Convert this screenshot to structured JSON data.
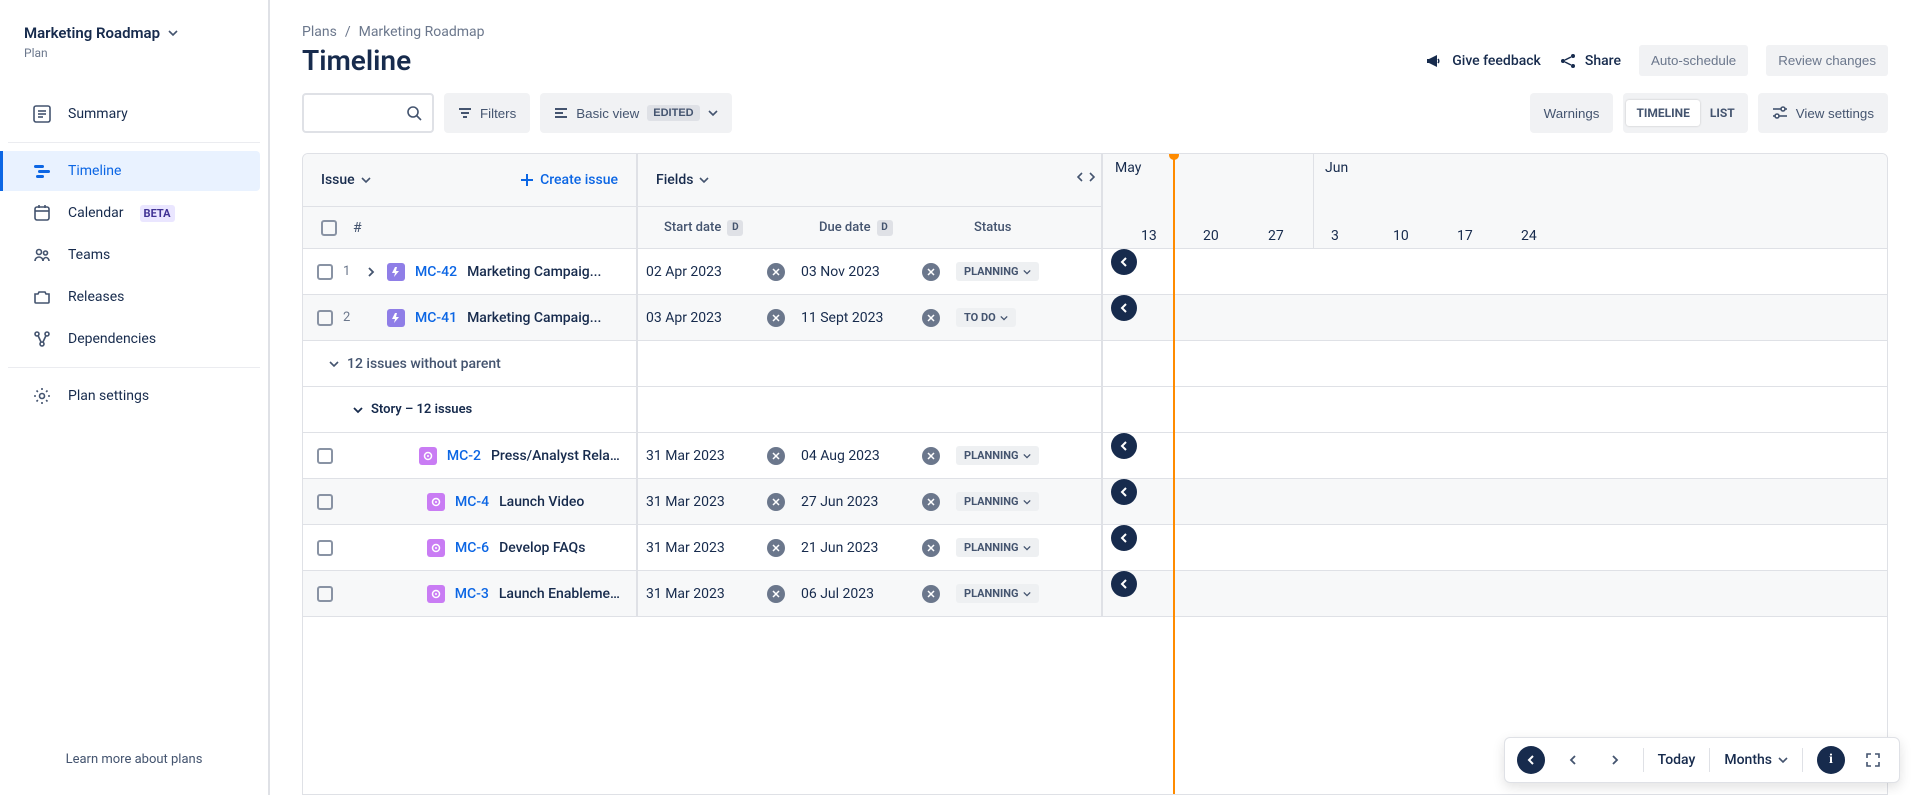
{
  "sidebar": {
    "plan_title": "Marketing Roadmap",
    "plan_sub": "Plan",
    "items": [
      {
        "label": "Summary"
      },
      {
        "label": "Timeline"
      },
      {
        "label": "Calendar"
      },
      {
        "label": "Teams"
      },
      {
        "label": "Releases"
      },
      {
        "label": "Dependencies"
      }
    ],
    "beta_label": "BETA",
    "settings_label": "Plan settings",
    "footer": "Learn more about plans"
  },
  "breadcrumb": {
    "root": "Plans",
    "current": "Marketing Roadmap"
  },
  "page_title": "Timeline",
  "header_actions": {
    "feedback": "Give feedback",
    "share": "Share",
    "autoschedule": "Auto-schedule",
    "review": "Review changes"
  },
  "toolbar": {
    "filters": "Filters",
    "basic_view": "Basic view",
    "edited": "EDITED",
    "warnings": "Warnings",
    "timeline": "TIMELINE",
    "list": "LIST",
    "view_settings": "View settings"
  },
  "table": {
    "issue_col": "Issue",
    "create": "Create issue",
    "fields_col": "Fields",
    "hash": "#",
    "start_date": "Start date",
    "due_date": "Due date",
    "status": "Status",
    "months": [
      "May",
      "Jun"
    ],
    "days": [
      "13",
      "20",
      "27",
      "3",
      "10",
      "17",
      "24"
    ]
  },
  "groups": {
    "no_parent": "12 issues without parent",
    "story": "Story – 12 issues"
  },
  "rows": [
    {
      "num": "1",
      "key": "MC-42",
      "summary": "Marketing Campaig...",
      "start": "02 Apr 2023",
      "due": "03 Nov 2023",
      "status": "PLANNING",
      "type": "epic",
      "expandable": true
    },
    {
      "num": "2",
      "key": "MC-41",
      "summary": "Marketing Campaig...",
      "start": "03 Apr 2023",
      "due": "11 Sept 2023",
      "status": "TO DO",
      "type": "epic",
      "expandable": false
    },
    {
      "num": "",
      "key": "MC-2",
      "summary": "Press/Analyst Relations",
      "start": "31 Mar 2023",
      "due": "04 Aug 2023",
      "status": "PLANNING",
      "type": "story"
    },
    {
      "num": "",
      "key": "MC-4",
      "summary": "Launch Video",
      "start": "31 Mar 2023",
      "due": "27 Jun 2023",
      "status": "PLANNING",
      "type": "story"
    },
    {
      "num": "",
      "key": "MC-6",
      "summary": "Develop FAQs",
      "start": "31 Mar 2023",
      "due": "21 Jun 2023",
      "status": "PLANNING",
      "type": "story"
    },
    {
      "num": "",
      "key": "MC-3",
      "summary": "Launch Enablement",
      "start": "31 Mar 2023",
      "due": "06 Jul 2023",
      "status": "PLANNING",
      "type": "story"
    }
  ],
  "footer_controls": {
    "today": "Today",
    "months": "Months"
  }
}
